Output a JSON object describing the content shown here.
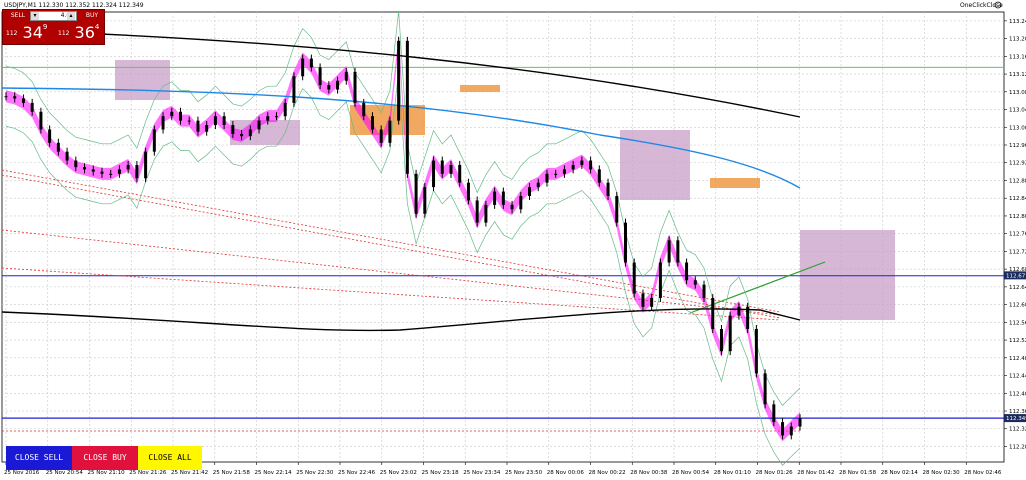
{
  "header": {
    "title": "USDJPY,M1  112.330 112.352 112.324 112.349",
    "one_click_label": "OneClickClose"
  },
  "one_click": {
    "sell_label": "SELL",
    "buy_label": "BUY",
    "lots": "4.00",
    "bid_prefix": "112",
    "bid_big": "34",
    "bid_sup": "9",
    "ask_prefix": "112",
    "ask_big": "36",
    "ask_sup": "4"
  },
  "buttons": {
    "close_sell": "CLOSE SELL",
    "close_buy": "CLOSE BUY",
    "close_all": "CLOSE ALL"
  },
  "chart_data": {
    "type": "line",
    "symbol": "USDJPY",
    "timeframe": "M1",
    "ylim": [
      112.25,
      113.265
    ],
    "price_ticks": [
      "113.245",
      "113.205",
      "113.165",
      "113.125",
      "113.085",
      "113.045",
      "113.005",
      "112.965",
      "112.925",
      "112.885",
      "112.845",
      "112.805",
      "112.765",
      "112.725",
      "112.685",
      "112.645",
      "112.605",
      "112.565",
      "112.525",
      "112.485",
      "112.445",
      "112.405",
      "112.365",
      "112.325",
      "112.285"
    ],
    "time_ticks": [
      "25 Nov 2016",
      "25 Nov 20:54",
      "25 Nov 21:10",
      "25 Nov 21:26",
      "25 Nov 21:42",
      "25 Nov 21:58",
      "25 Nov 22:14",
      "25 Nov 22:30",
      "25 Nov 22:46",
      "25 Nov 23:02",
      "25 Nov 23:18",
      "25 Nov 23:34",
      "25 Nov 23:50",
      "28 Nov 00:06",
      "28 Nov 00:22",
      "28 Nov 00:38",
      "28 Nov 00:54",
      "28 Nov 01:10",
      "28 Nov 01:26",
      "28 Nov 01:42",
      "28 Nov 01:58",
      "28 Nov 02:14",
      "28 Nov 02:30",
      "28 Nov 02:46"
    ],
    "close_series": [
      113.075,
      113.07,
      113.06,
      113.04,
      113.0,
      112.97,
      112.95,
      112.93,
      112.915,
      112.91,
      112.905,
      112.9,
      112.9,
      112.91,
      112.92,
      112.89,
      112.95,
      113.0,
      113.03,
      113.04,
      113.02,
      113.02,
      112.995,
      113.01,
      113.03,
      113.01,
      112.99,
      112.985,
      113.0,
      113.02,
      113.03,
      113.03,
      113.06,
      113.12,
      113.16,
      113.14,
      113.1,
      113.09,
      113.11,
      113.13,
      113.06,
      113.03,
      113.0,
      112.97,
      113.02,
      113.2,
      112.9,
      112.81,
      112.87,
      112.93,
      112.9,
      112.92,
      112.88,
      112.84,
      112.79,
      112.83,
      112.86,
      112.83,
      112.82,
      112.85,
      112.87,
      112.88,
      112.9,
      112.9,
      112.91,
      112.92,
      112.93,
      112.91,
      112.88,
      112.85,
      112.79,
      112.7,
      112.63,
      112.6,
      112.62,
      112.7,
      112.75,
      112.7,
      112.66,
      112.65,
      112.62,
      112.55,
      112.5,
      112.58,
      112.6,
      112.55,
      112.45,
      112.38,
      112.34,
      112.31,
      112.33,
      112.349
    ],
    "series": [
      {
        "name": "OneClickClose",
        "kind": "level",
        "values": [
          112.349
        ]
      },
      {
        "name": "",
        "kind": "level",
        "values": [
          112.67
        ]
      },
      {
        "name": "",
        "kind": "level",
        "values": [
          113.14
        ]
      },
      {
        "name": "",
        "kind": "level",
        "values": [
          112.32
        ]
      }
    ],
    "level_labels": [
      "112.349",
      "112.671"
    ],
    "colors": {
      "candles": "#000000",
      "ma_blue": "#1e88e5",
      "ma_black": "#000000",
      "bands": "#66bb88",
      "ichimoku_cloud_purple": "#c8a0c8",
      "ichimoku_cloud_orange": "#f0a050",
      "kumo_magenta": "#ff00ff",
      "hline_blue": "#1f1fd8",
      "hline_green": "#6abf6a",
      "dotted_red": "#e03030",
      "price_badge": "#1b2b5e"
    }
  }
}
